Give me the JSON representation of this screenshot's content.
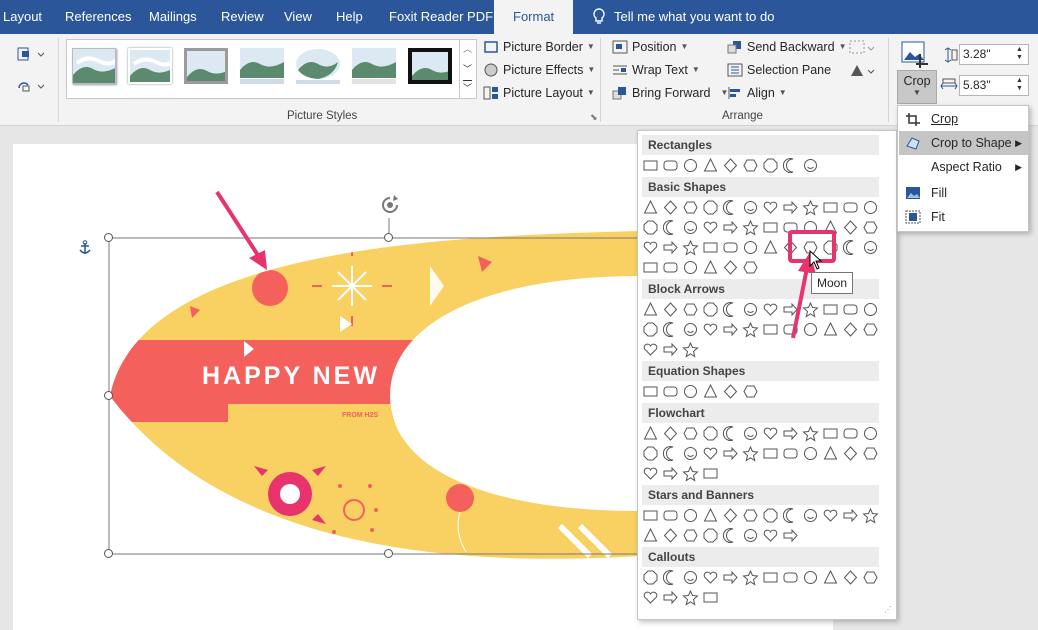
{
  "tabs": [
    "Layout",
    "References",
    "Mailings",
    "Review",
    "View",
    "Help",
    "Foxit Reader PDF",
    "Format"
  ],
  "active_tab": "Format",
  "tell_me": "Tell me what you want to do",
  "ribbon": {
    "picture_styles": {
      "label": "Picture Styles",
      "border": "Picture Border",
      "effects": "Picture Effects",
      "layout": "Picture Layout"
    },
    "arrange": {
      "label": "Arrange",
      "position": "Position",
      "wrap_text": "Wrap Text",
      "bring_forward": "Bring Forward",
      "send_backward": "Send Backward",
      "selection_pane": "Selection Pane",
      "align": "Align"
    },
    "size": {
      "crop": "Crop",
      "height": "3.28\"",
      "width": "5.83\""
    }
  },
  "crop_menu": {
    "items": [
      "Crop",
      "Crop to Shape",
      "Aspect Ratio",
      "Fill",
      "Fit"
    ],
    "highlighted": "Crop to Shape"
  },
  "shape_categories": [
    "Rectangles",
    "Basic Shapes",
    "Block Arrows",
    "Equation Shapes",
    "Flowchart",
    "Stars and Banners",
    "Callouts"
  ],
  "tooltip": "Moon",
  "document": {
    "banner_text": "HAPPY NEW",
    "sub_text": "FROM H2S"
  },
  "colors": {
    "accent": "#2b579a",
    "highlight": "#e8336d",
    "yellow": "#f9d062",
    "red": "#f4605b"
  }
}
